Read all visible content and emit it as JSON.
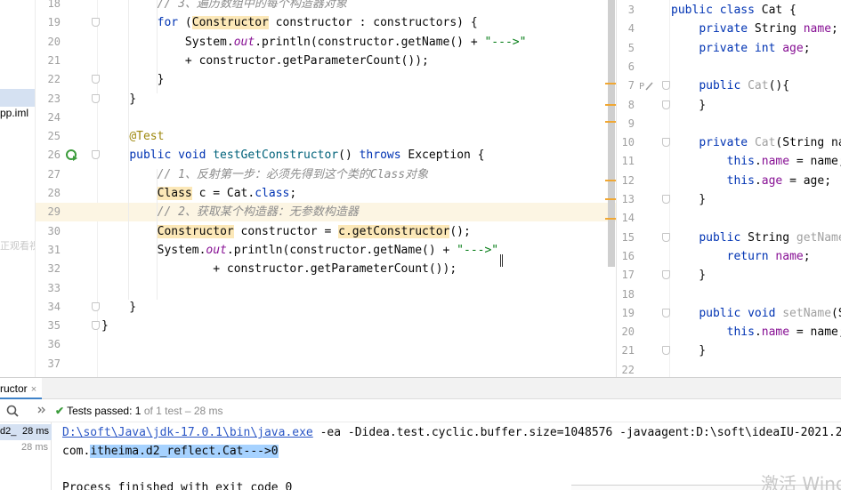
{
  "project_tree": {
    "file_label": "pp.iml",
    "ghost_text": "正观看视频"
  },
  "left_editor": {
    "lines": [
      {
        "n": "18",
        "html": "        <span class=\"cm\">// 3、遍历数组中的每个构造器对象</span>"
      },
      {
        "n": "19",
        "html": "        <span class=\"kw\">for</span> (<span class=\"hl\">Constructor</span> constructor : constructors) {"
      },
      {
        "n": "20",
        "html": "            System.<span class=\"st\">out</span>.println(constructor.getName() + <span class=\"str\">\"---&gt;\"</span>"
      },
      {
        "n": "21",
        "html": "            + constructor.getParameterCount());"
      },
      {
        "n": "22",
        "html": "        }"
      },
      {
        "n": "23",
        "html": "    }"
      },
      {
        "n": "24",
        "html": ""
      },
      {
        "n": "25",
        "html": "    <span class=\"ann\">@Test</span>"
      },
      {
        "n": "26",
        "html": "    <span class=\"kw\">public void</span> <span class=\"fn\">testGetConstructor</span>() <span class=\"kw\">throws</span> Exception {"
      },
      {
        "n": "27",
        "html": "        <span class=\"cm\">// 1、反射第一步：必须先得到这个类的Class对象</span>"
      },
      {
        "n": "28",
        "html": "        <span class=\"hl\">Class</span> c = Cat.<span class=\"kw\">class</span>;"
      },
      {
        "n": "29",
        "html": "        <span class=\"cm\">// 2、获取某个构造器：无参数构造器</span>"
      },
      {
        "n": "30",
        "html": "        <span class=\"hl\">Constructor</span> constructor = <span class=\"hl\">c.getConstructor</span>();"
      },
      {
        "n": "31",
        "html": "        System.<span class=\"st\">out</span>.println(constructor.getName() + <span class=\"str\">\"---&gt;\"</span>"
      },
      {
        "n": "32",
        "html": "                + constructor.getParameterCount());"
      },
      {
        "n": "33",
        "html": ""
      },
      {
        "n": "34",
        "html": "    }"
      },
      {
        "n": "35",
        "html": "}"
      },
      {
        "n": "36",
        "html": ""
      },
      {
        "n": "37",
        "html": ""
      }
    ]
  },
  "right_editor": {
    "lines": [
      {
        "n": "3",
        "html": "<span class=\"kw\">public class</span> Cat {"
      },
      {
        "n": "4",
        "html": "    <span class=\"kw\">private</span> String <span class=\"fld\">name</span>;"
      },
      {
        "n": "5",
        "html": "    <span class=\"kw\">private int</span> <span class=\"fld\">age</span>;"
      },
      {
        "n": "6",
        "html": ""
      },
      {
        "n": "7",
        "html": "    <span class=\"kw\">public</span> <span class=\"gray\">Cat</span>(){"
      },
      {
        "n": "8",
        "html": "    }"
      },
      {
        "n": "9",
        "html": ""
      },
      {
        "n": "10",
        "html": "    <span class=\"kw\">private</span> <span class=\"gray\">Cat</span>(String na"
      },
      {
        "n": "11",
        "html": "        <span class=\"kw\">this</span>.<span class=\"fld\">name</span> = name;"
      },
      {
        "n": "12",
        "html": "        <span class=\"kw\">this</span>.<span class=\"fld\">age</span> = age;"
      },
      {
        "n": "13",
        "html": "    }"
      },
      {
        "n": "14",
        "html": ""
      },
      {
        "n": "15",
        "html": "    <span class=\"kw\">public</span> String <span class=\"gray\">getName</span>"
      },
      {
        "n": "16",
        "html": "        <span class=\"kw\">return</span> <span class=\"fld\">name</span>;"
      },
      {
        "n": "17",
        "html": "    }"
      },
      {
        "n": "18",
        "html": ""
      },
      {
        "n": "19",
        "html": "    <span class=\"kw\">public void</span> <span class=\"gray\">setName</span>(S"
      },
      {
        "n": "20",
        "html": "        <span class=\"kw\">this</span>.<span class=\"fld\">name</span> = name;"
      },
      {
        "n": "21",
        "html": "    }"
      },
      {
        "n": "22",
        "html": ""
      }
    ]
  },
  "run_panel": {
    "tab_label": "ructor",
    "tab_close": "×",
    "tests_check": "✔",
    "tests_passed": "Tests passed:",
    "tests_count": "1",
    "tests_rest": "of 1 test – 28 ms",
    "tree_row1_name": "d2_",
    "tree_row1_time": "28 ms",
    "tree_row2_time": "28 ms",
    "console_line1_link": "D:\\soft\\Java\\jdk-17.0.1\\bin\\java.exe",
    "console_line1_rest": " -ea -Didea.test.cyclic.buffer.size=1048576 -javaagent:D:\\soft\\ideaIU-2021.2",
    "console_line2_pre": "com.",
    "console_line2_sel": "itheima.d2_reflect.Cat--->0",
    "console_line3": "Process finished with exit code 0"
  },
  "watermark": "激活 Wind"
}
